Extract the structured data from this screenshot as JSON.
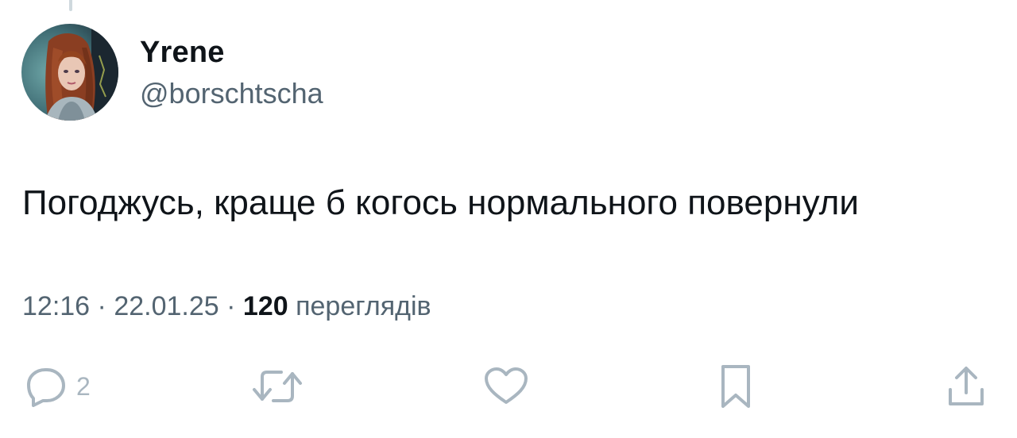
{
  "user": {
    "name": "Yrene",
    "handle": "@borschtscha",
    "avatar": "avatar-portrait"
  },
  "tweet": {
    "text": "Погоджусь, краще б когось нормального повернули"
  },
  "meta": {
    "time": "12:16",
    "separator": "·",
    "date": "22.01.25",
    "views_count": "120",
    "views_label": "переглядів"
  },
  "actions": {
    "reply": {
      "icon": "reply-icon",
      "count": "2"
    },
    "retweet": {
      "icon": "retweet-icon"
    },
    "like": {
      "icon": "heart-icon"
    },
    "bookmark": {
      "icon": "bookmark-icon"
    },
    "share": {
      "icon": "share-icon"
    }
  },
  "colors": {
    "text": "#0f1419",
    "secondary": "#536471",
    "icon": "#a9b6c0",
    "thread_line": "#cfd9de"
  }
}
